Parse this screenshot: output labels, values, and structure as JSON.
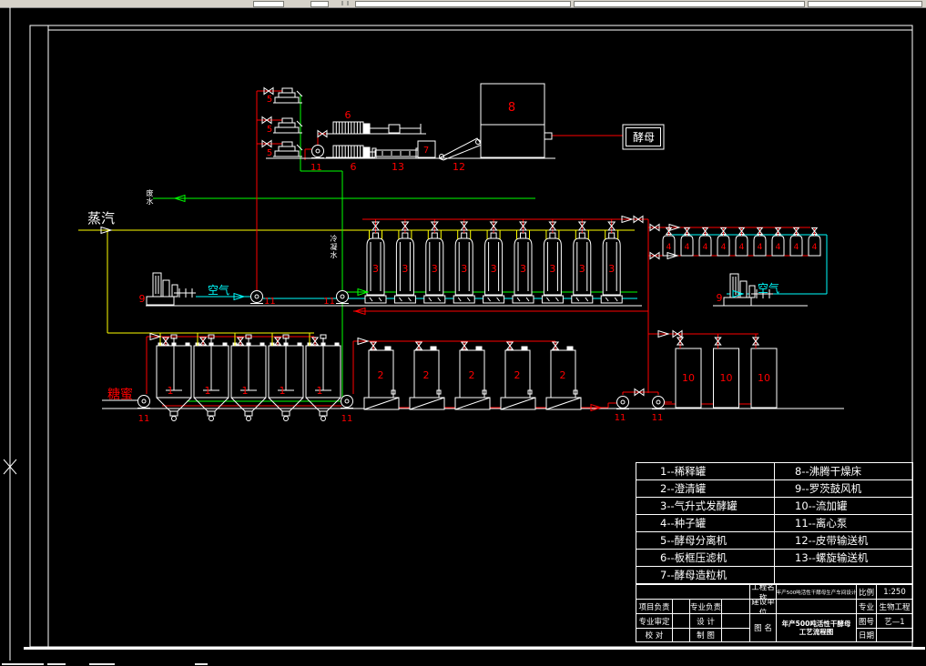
{
  "drawing": {
    "labels": {
      "steam": "蒸汽",
      "air": "空气",
      "molasses": "糖蜜",
      "yeast": "酵母",
      "waste_water": "废水",
      "condensate": "冷凝水"
    },
    "equipment": {
      "dilution_tank": {
        "number": "1",
        "name": "稀释罐",
        "count": 5
      },
      "clarifier_tank": {
        "number": "2",
        "name": "澄清罐",
        "count": 5
      },
      "airlift_fermenter": {
        "number": "3",
        "name": "气升式发酵罐",
        "count": 9
      },
      "seed_tank": {
        "number": "4",
        "name": "种子罐",
        "count": 9
      },
      "yeast_separator": {
        "number": "5",
        "name": "酵母分离机",
        "count": 3
      },
      "filter_press": {
        "number": "6",
        "name": "板框压滤机",
        "count": 2
      },
      "granulator": {
        "number": "7",
        "name": "酵母造粒机",
        "count": 1
      },
      "drying_bed": {
        "number": "8",
        "name": "沸腾干燥床",
        "count": 1
      },
      "roots_blower": {
        "number": "9",
        "name": "罗茨鼓风机",
        "count": 2
      },
      "feed_tank": {
        "number": "10",
        "name": "流加罐",
        "count": 3
      },
      "centrifugal_pump": {
        "number": "11",
        "name": "离心泵",
        "count": 7
      },
      "belt_conveyor": {
        "number": "12",
        "name": "皮带输送机",
        "count": 1
      },
      "screw_conveyor": {
        "number": "13",
        "name": "螺旋输送机",
        "count": 1
      }
    },
    "colors": {
      "background": "#000000",
      "line_white": "#ffffff",
      "pipe_red": "#ff0000",
      "pipe_green": "#00ff00",
      "pipe_yellow": "#ffff00",
      "pipe_cyan": "#00ffff",
      "label_red": "#ff0000"
    }
  },
  "legend": {
    "rows": [
      {
        "left": "1--稀释罐",
        "right": "8--沸腾干燥床"
      },
      {
        "left": "2--澄清罐",
        "right": "9--罗茨鼓风机"
      },
      {
        "left": "3--气升式发酵罐",
        "right": "10--流加罐"
      },
      {
        "left": "4--种子罐",
        "right": "11--离心泵"
      },
      {
        "left": "5--酵母分离机",
        "right": "12--皮带输送机"
      },
      {
        "left": "6--板框压滤机",
        "right": "13--螺旋输送机"
      },
      {
        "left": "7--酵母造粒机",
        "right": ""
      }
    ]
  },
  "title_block": {
    "project_name_label": "工程名称",
    "project_name": "年产500吨活性干酵母生产车间设计",
    "scale_label": "比例",
    "scale": "1:250",
    "project_lead_label": "项目负责",
    "major_lead_label": "专业负责",
    "owner_label": "建设单位",
    "major_label": "专业",
    "major": "生物工程",
    "major_review_label": "专业审定",
    "design_label": "设 计",
    "drawing_name_label": "图 名",
    "drawing_name_line1": "年产500吨活性干酵母",
    "drawing_name_line2": "工艺流程图",
    "drawing_no_label": "图号",
    "drawing_no": "艺—1",
    "check_label": "校 对",
    "draft_label": "制 图",
    "date_label": "日期",
    "date": ""
  }
}
